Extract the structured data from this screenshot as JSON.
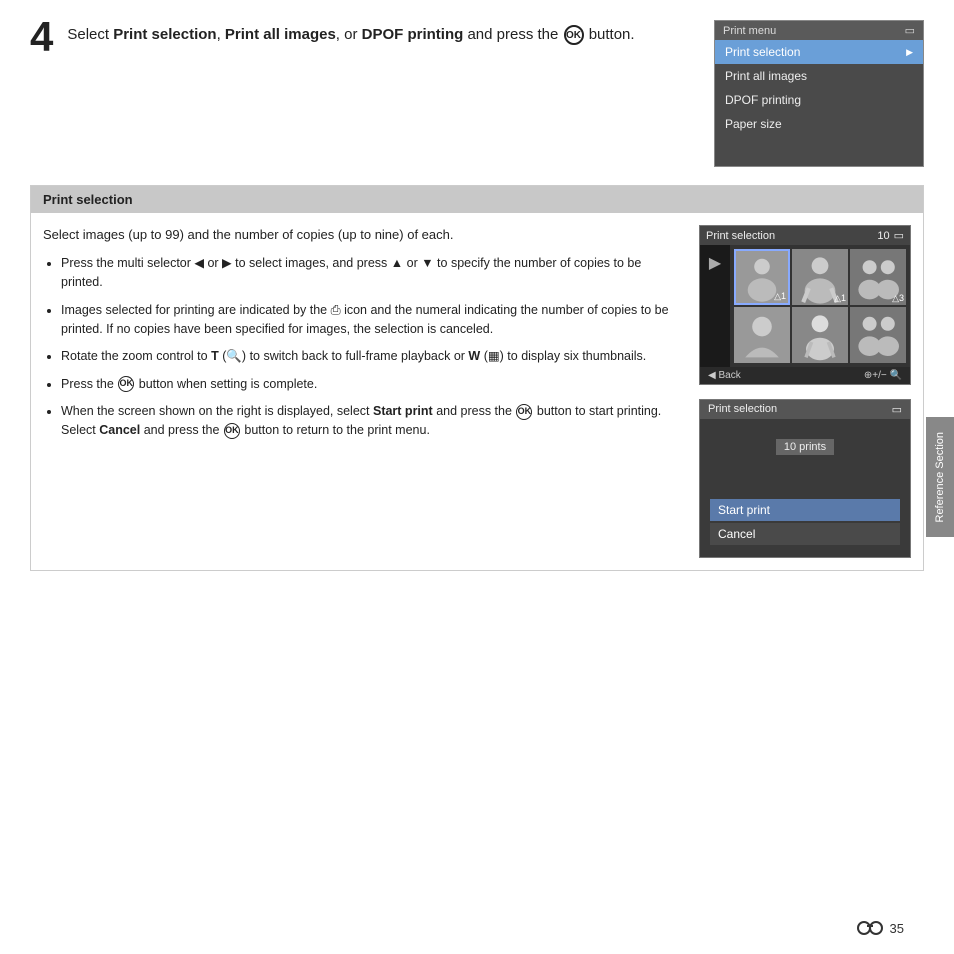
{
  "step": {
    "number": "4",
    "text_before": "Select ",
    "bold1": "Print selection",
    "text_mid1": ", ",
    "bold2": "Print all images",
    "text_mid2": ", or ",
    "bold3": "DPOF printing",
    "text_after": " and press the ",
    "ok_label": "OK",
    "text_end": " button."
  },
  "print_menu": {
    "title": "Print menu",
    "items": [
      {
        "label": "Print selection",
        "selected": true
      },
      {
        "label": "Print all images",
        "selected": false
      },
      {
        "label": "DPOF printing",
        "selected": false
      },
      {
        "label": "Paper size",
        "selected": false
      }
    ]
  },
  "print_selection_section": {
    "header": "Print selection",
    "intro": "Select images (up to 99) and the number of copies (up to nine) of each.",
    "bullets": [
      "Press the multi selector ◀ or ▶ to select images, and press ▲ or ▼ to specify the number of copies to be printed.",
      "Images selected for printing are indicated by the 🖨 icon and the numeral indicating the number of copies to be printed. If no copies have been specified for images, the selection is canceled.",
      "Rotate the zoom control to T (🔍) to switch back to full-frame playback or W (▦) to display six thumbnails.",
      "Press the OK button when setting is complete.",
      "When the screen shown on the right is displayed, select Start print and press the OK button to start printing.\nSelect Cancel and press the OK button to return to the print menu."
    ]
  },
  "cam_top": {
    "title": "Print selection",
    "count": "10",
    "thumbs": [
      {
        "label": "△1",
        "highlight": true
      },
      {
        "label": "△1",
        "highlight": false
      },
      {
        "label": "△3",
        "highlight": false
      },
      {
        "label": "",
        "highlight": false
      },
      {
        "label": "",
        "highlight": false
      },
      {
        "label": "",
        "highlight": false
      }
    ],
    "footer_left": "◀ Back",
    "footer_right": "⊕+/− 🔍"
  },
  "cam_bottom": {
    "title": "Print selection",
    "count_label": "10 prints",
    "start_print": "Start print",
    "cancel": "Cancel"
  },
  "side_tab": "Reference Section",
  "page_number": "35"
}
